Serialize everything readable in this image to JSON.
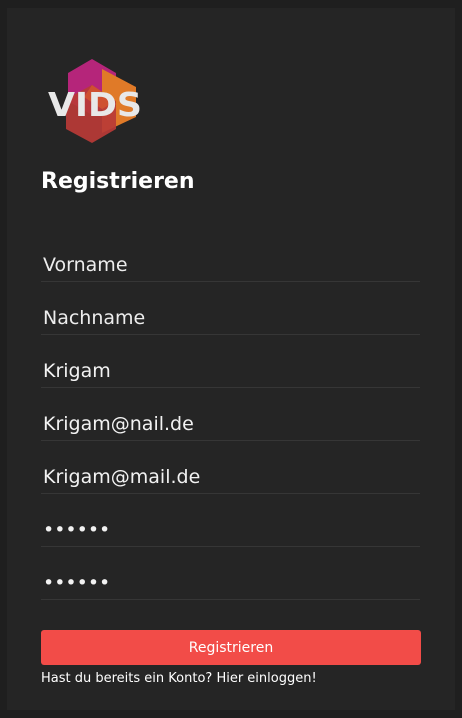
{
  "brand": {
    "logo_text": "VIDS",
    "colors": {
      "magenta": "#b5257a",
      "orange": "#e07a28",
      "red": "#b83a36",
      "text": "#e8e8e8"
    }
  },
  "form": {
    "title": "Registrieren",
    "fields": {
      "first_name": {
        "placeholder": "Vorname",
        "value": ""
      },
      "last_name": {
        "placeholder": "Nachname",
        "value": ""
      },
      "username": {
        "placeholder": "",
        "value": "Krigam"
      },
      "email": {
        "placeholder": "",
        "value": "Krigam@nail.de"
      },
      "email_confirm": {
        "placeholder": "",
        "value": "Krigam@mail.de"
      },
      "password": {
        "placeholder": "",
        "value": "••••••"
      },
      "password_confirm": {
        "placeholder": "",
        "value": "••••••"
      }
    },
    "submit_label": "Registrieren",
    "login_prompt": "Hast du bereits ein Konto?",
    "login_link": "Hier einloggen!"
  },
  "colors": {
    "page_background": "#1f1f1f",
    "panel_background": "#252525",
    "accent": "#f24c48",
    "divider": "#363636"
  }
}
